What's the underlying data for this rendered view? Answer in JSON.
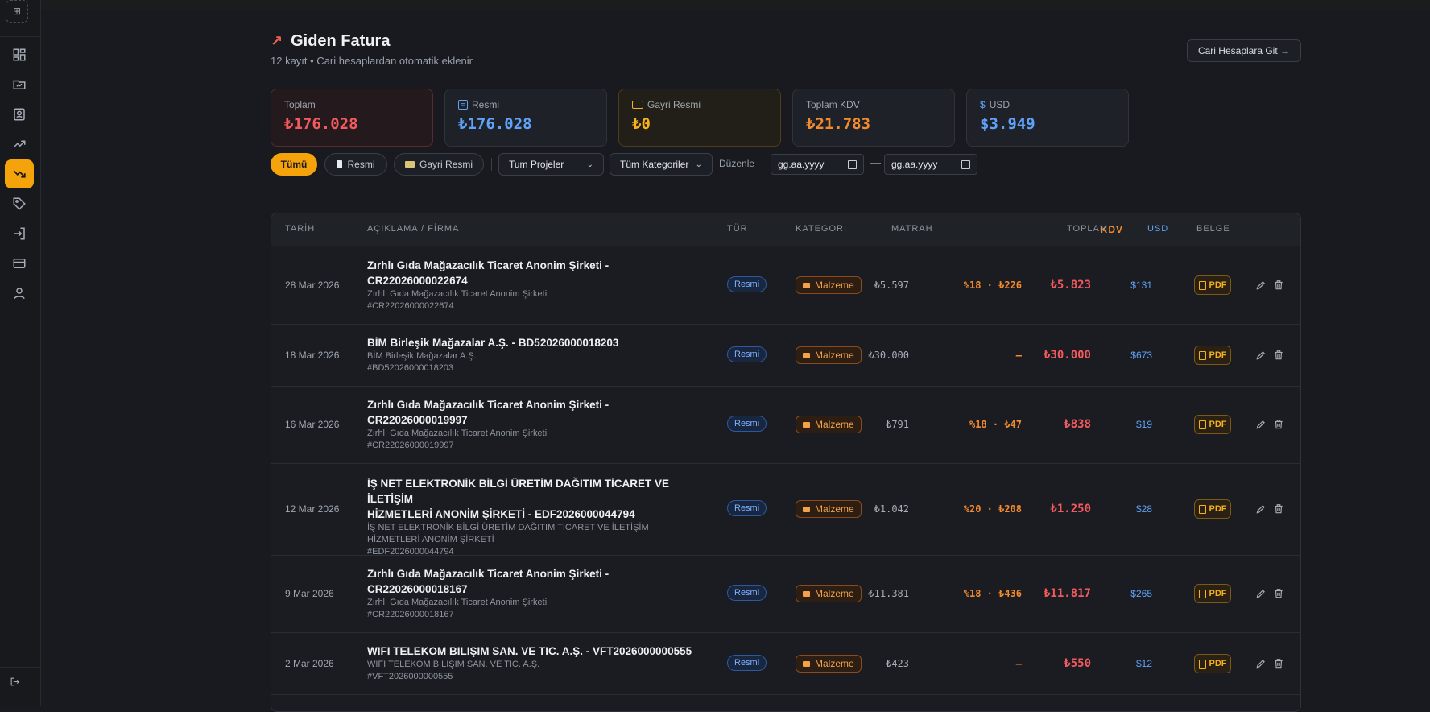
{
  "sidebar": {
    "logo": "⊞",
    "items": [
      {
        "name": "dashboard",
        "icon": "grid-icon"
      },
      {
        "name": "projects",
        "icon": "folder-icon"
      },
      {
        "name": "contacts",
        "icon": "contact-icon"
      },
      {
        "name": "income",
        "icon": "trend-up-icon"
      },
      {
        "name": "expense",
        "icon": "trend-down-icon",
        "active": true
      },
      {
        "name": "tags",
        "icon": "tag-icon"
      },
      {
        "name": "import",
        "icon": "import-icon"
      },
      {
        "name": "cards",
        "icon": "card-icon"
      },
      {
        "name": "profile",
        "icon": "user-icon"
      }
    ],
    "logout_icon": "logout-icon"
  },
  "header": {
    "title": "Giden Fatura",
    "subtitle": "12 kayıt • Cari hesaplardan otomatik eklenir",
    "cari_button": "Cari Hesaplara Git →"
  },
  "summary": {
    "toplam": {
      "label": "Toplam",
      "value": "₺176.028"
    },
    "resmi": {
      "label": "Resmi",
      "value": "₺176.028"
    },
    "gayri": {
      "label": "Gayri Resmi",
      "value": "₺0"
    },
    "kdv": {
      "label": "Toplam KDV",
      "value": "₺21.783"
    },
    "usd": {
      "label": "USD",
      "value": "$3.949"
    }
  },
  "filters": {
    "all": "Tümü",
    "resmi": "Resmi",
    "gayri": "Gayri Resmi",
    "projects": "Tum Projeler",
    "categories": "Tüm Kategoriler",
    "edit": "Düzenle",
    "date_from_placeholder": "gg.aa.yyyy",
    "date_to_placeholder": "gg.aa.yyyy",
    "date_sep": "—"
  },
  "table": {
    "columns": {
      "tarih": "TARİH",
      "aciklama": "AÇIKLAMA / FİRMA",
      "tur": "TÜR",
      "kategori": "KATEGORİ",
      "matrah": "MATRAH",
      "kdv": "KDV",
      "toplam": "TOPLAM",
      "usd": "USD",
      "belge": "BELGE"
    },
    "rows": [
      {
        "date": "28 Mar 2026",
        "title1": "Zırhlı Gıda Mağazacılık Ticaret Anonim Şirketi -",
        "title2": "CR22026000022674",
        "sub1": "Zırhlı Gıda Mağazacılık Ticaret Anonim Şirketi",
        "sub2": "#CR22026000022674",
        "type": "Resmi",
        "category": "Malzeme",
        "matrah": "₺5.597",
        "kdv": "%18 · ₺226",
        "toplam": "₺5.823",
        "usd": "$131",
        "doc": "PDF"
      },
      {
        "date": "18 Mar 2026",
        "title1": "BİM Birleşik Mağazalar A.Ş. - BD52026000018203",
        "title2": "",
        "sub1": "BİM Birleşik Mağazalar A.Ş.",
        "sub2": "#BD52026000018203",
        "type": "Resmi",
        "category": "Malzeme",
        "matrah": "₺30.000",
        "kdv": "—",
        "toplam": "₺30.000",
        "usd": "$673",
        "doc": "PDF"
      },
      {
        "date": "16 Mar 2026",
        "title1": "Zırhlı Gıda Mağazacılık Ticaret Anonim Şirketi -",
        "title2": "CR22026000019997",
        "sub1": "Zırhlı Gıda Mağazacılık Ticaret Anonim Şirketi",
        "sub2": "#CR22026000019997",
        "type": "Resmi",
        "category": "Malzeme",
        "matrah": "₺791",
        "kdv": "%18 · ₺47",
        "toplam": "₺838",
        "usd": "$19",
        "doc": "PDF"
      },
      {
        "date": "12 Mar 2026",
        "title1": "İŞ NET ELEKTRONİK BİLGİ ÜRETİM DAĞITIM TİCARET VE İLETİŞİM",
        "title2": "HİZMETLERİ ANONİM ŞİRKETİ - EDF2026000044794",
        "sub1": "İŞ NET ELEKTRONİK BİLGİ ÜRETİM DAĞITIM TİCARET VE İLETİŞİM",
        "sub1b": "HİZMETLERİ ANONİM ŞİRKETİ",
        "sub2": "#EDF2026000044794",
        "type": "Resmi",
        "category": "Malzeme",
        "matrah": "₺1.042",
        "kdv": "%20 · ₺208",
        "toplam": "₺1.250",
        "usd": "$28",
        "doc": "PDF"
      },
      {
        "date": "9 Mar 2026",
        "title1": "Zırhlı Gıda Mağazacılık Ticaret Anonim Şirketi -",
        "title2": "CR22026000018167",
        "sub1": "Zırhlı Gıda Mağazacılık Ticaret Anonim Şirketi",
        "sub2": "#CR22026000018167",
        "type": "Resmi",
        "category": "Malzeme",
        "matrah": "₺11.381",
        "kdv": "%18 · ₺436",
        "toplam": "₺11.817",
        "usd": "$265",
        "doc": "PDF"
      },
      {
        "date": "2 Mar 2026",
        "title1": "WIFI TELEKOM BILIŞIM SAN. VE TIC. A.Ş. - VFT2026000000555",
        "title2": "",
        "sub1": "WIFI TELEKOM BILIŞIM SAN. VE TIC. A.Ş.",
        "sub2": "#VFT2026000000555",
        "type": "Resmi",
        "category": "Malzeme",
        "matrah": "₺423",
        "kdv": "—",
        "toplam": "₺550",
        "usd": "$12",
        "doc": "PDF"
      }
    ]
  }
}
